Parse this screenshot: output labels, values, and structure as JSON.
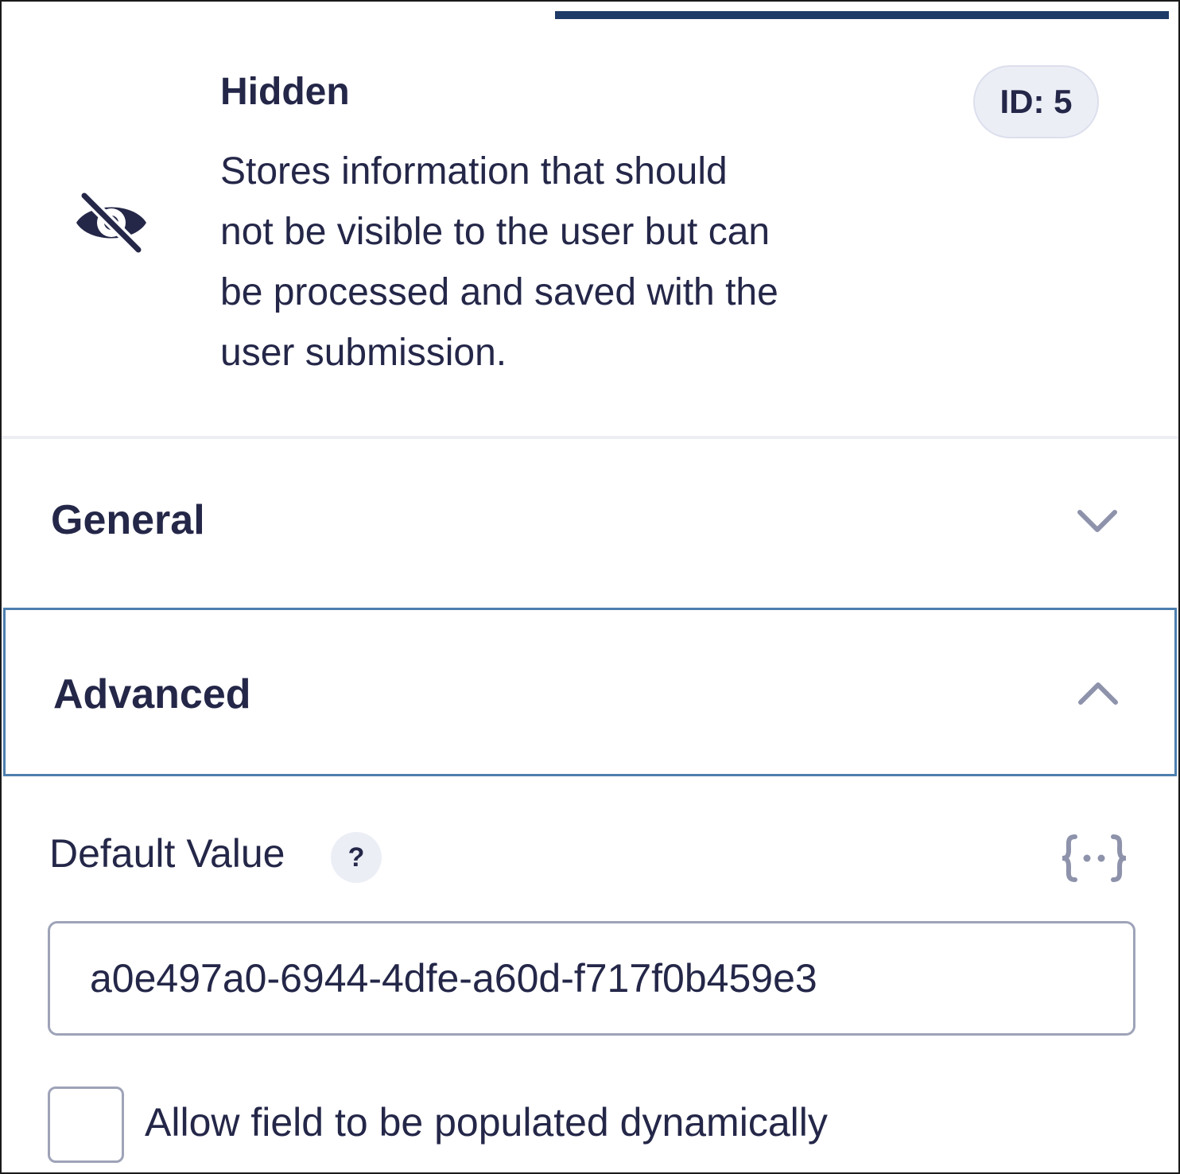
{
  "field": {
    "icon": "eye-slash-icon",
    "title": "Hidden",
    "description_lines": [
      "Stores information that should",
      "not be visible to the user but can",
      "be processed and saved with the",
      "user submission."
    ],
    "id_badge": "ID: 5"
  },
  "panels": {
    "general": {
      "label": "General",
      "state": "collapsed",
      "icon": "chevron-down-icon"
    },
    "advanced": {
      "label": "Advanced",
      "state": "expanded",
      "icon": "chevron-up-icon"
    }
  },
  "advanced": {
    "default_value": {
      "label": "Default Value",
      "help": "?",
      "merge_tag_icon": "merge-tag-icon",
      "value": "a0e497a0-6944-4dfe-a60d-f717f0b459e3"
    },
    "dynamic_population": {
      "label": "Allow field to be populated dynamically",
      "checked": false
    }
  },
  "colors": {
    "text": "#242748",
    "tab_indicator": "#1e3a66",
    "focus_border": "#4d7fae",
    "badge_bg": "#eceef6",
    "control_border": "#9ea3b8",
    "chevron": "#8e93ab"
  }
}
